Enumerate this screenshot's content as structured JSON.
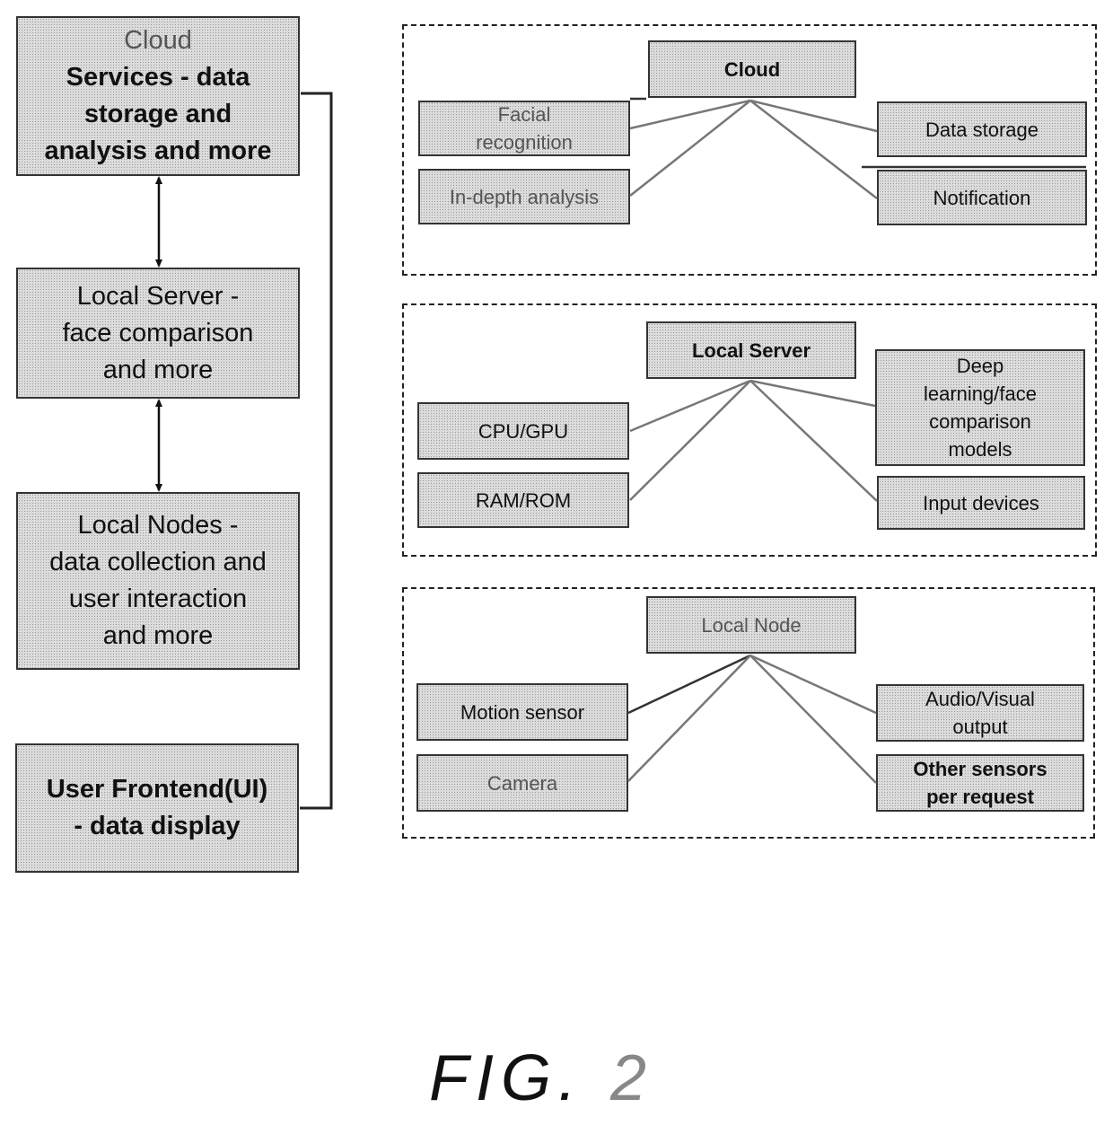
{
  "hierarchy": {
    "cloud_services": {
      "line1": "Cloud",
      "rest": "Services - data\nstorage and\nanalysis and more"
    },
    "local_server": "Local Server -\nface comparison\nand more",
    "local_nodes": "Local Nodes -\ndata collection and\nuser interaction\nand more",
    "user_frontend": "User Frontend(UI)\n- data display"
  },
  "groups": {
    "cloud": {
      "hub": "Cloud",
      "left": [
        "Facial\nrecognition",
        "In-depth analysis"
      ],
      "right": [
        "Data storage",
        "Notification"
      ]
    },
    "local_server": {
      "hub": "Local Server",
      "left": [
        "CPU/GPU",
        "RAM/ROM"
      ],
      "right": [
        "Deep\nlearning/face\ncomparison\nmodels",
        "Input devices"
      ]
    },
    "local_node": {
      "hub": "Local Node",
      "left": [
        "Motion sensor",
        "Camera"
      ],
      "right": [
        "Audio/Visual\noutput",
        "Other sensors\nper request"
      ]
    }
  },
  "figure_label": {
    "prefix": "FIG.",
    "number": "2"
  }
}
